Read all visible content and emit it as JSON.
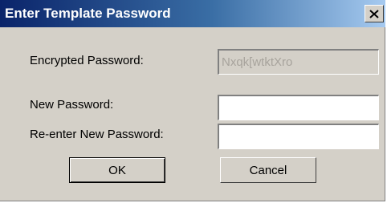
{
  "dialog": {
    "title": "Enter Template Password",
    "close_label": "close"
  },
  "fields": {
    "encrypted_label": "Encrypted Password:",
    "encrypted_value": "Nxqk[wtktXro",
    "new_label": "New Password:",
    "new_value": "",
    "reenter_label": "Re-enter New Password:",
    "reenter_value": ""
  },
  "buttons": {
    "ok_label": "OK",
    "cancel_label": "Cancel"
  },
  "colors": {
    "titlebar_start": "#0a246a",
    "titlebar_end": "#a6caf0",
    "face": "#d4d0c8"
  },
  "icons": {
    "close": "close-icon"
  }
}
